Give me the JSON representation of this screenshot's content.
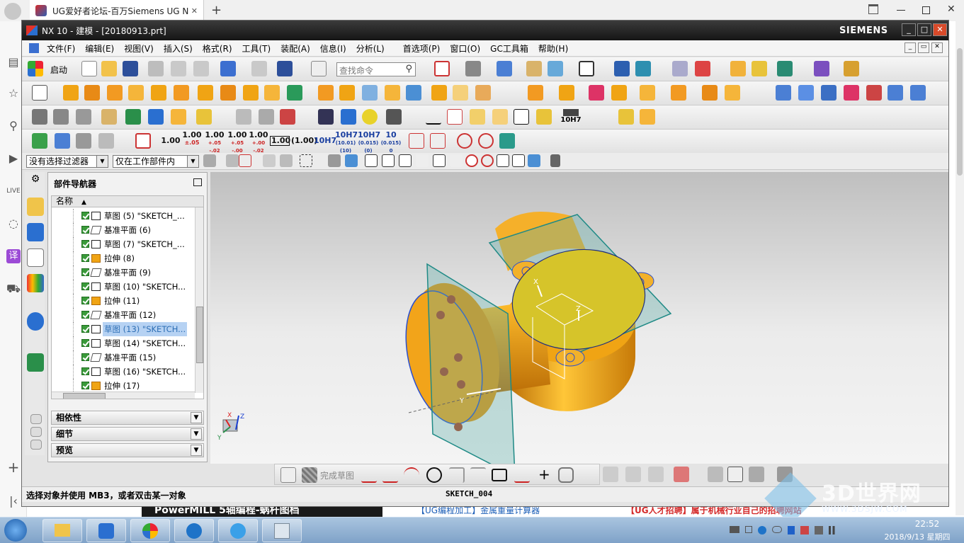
{
  "browser": {
    "tab_title": "UG爱好者论坛-百万Siemens UG N",
    "tab_close": "✕",
    "new_tab": "+"
  },
  "window": {
    "title": "NX 10 - 建模 - [20180913.prt]",
    "brand": "SIEMENS"
  },
  "menu": [
    "文件(F)",
    "编辑(E)",
    "视图(V)",
    "插入(S)",
    "格式(R)",
    "工具(T)",
    "装配(A)",
    "信息(I)",
    "分析(L)",
    "首选项(P)",
    "窗口(O)",
    "GC工具箱",
    "帮助(H)"
  ],
  "toolbar": {
    "start_label": "启动",
    "search_placeholder": "查找命令",
    "dim_values": [
      "1.00",
      "1.00",
      "1.00",
      "1.00",
      "1.00",
      "1.00",
      "(1.00)",
      "10H7",
      "10H7",
      "10H7",
      "10"
    ],
    "dim_subs": [
      "",
      "±.05",
      "+.05\n-.02",
      "+.05\n-.00",
      "+.00\n-.02",
      "",
      "",
      "",
      "(10.01)\n(10)",
      "(0.015)\n(0)",
      "(0.015)\n0"
    ],
    "fit_label": "10H7"
  },
  "filter": {
    "selection_filter": "没有选择过滤器",
    "scope": "仅在工作部件内"
  },
  "navigator": {
    "title": "部件导航器",
    "column_name": "名称",
    "rows": [
      {
        "icon": "sketch",
        "text": "草图 (5) \"SKETCH_..."
      },
      {
        "icon": "datum",
        "text": "基准平面 (6)"
      },
      {
        "icon": "sketch",
        "text": "草图 (7) \"SKETCH_..."
      },
      {
        "icon": "extrude",
        "text": "拉伸 (8)"
      },
      {
        "icon": "datum",
        "text": "基准平面 (9)"
      },
      {
        "icon": "sketch",
        "text": "草图 (10) \"SKETCH..."
      },
      {
        "icon": "extrude",
        "text": "拉伸 (11)"
      },
      {
        "icon": "datum",
        "text": "基准平面 (12)"
      },
      {
        "icon": "sketch",
        "text": "草图 (13) \"SKETCH...",
        "selected": true
      },
      {
        "icon": "sketch",
        "text": "草图 (14) \"SKETCH..."
      },
      {
        "icon": "datum",
        "text": "基准平面 (15)"
      },
      {
        "icon": "sketch",
        "text": "草图 (16) \"SKETCH..."
      },
      {
        "icon": "extrude",
        "text": "拉伸 (17)"
      }
    ],
    "panels": [
      "相依性",
      "细节",
      "预览"
    ]
  },
  "sketch_toolbar": {
    "finish_label": "完成草图"
  },
  "status": {
    "message": "选择对象并使用 MB3，或者双击某一对象",
    "sketch_name": "SKETCH_004"
  },
  "axes": {
    "x": "X",
    "y": "Y",
    "z": "Z"
  },
  "background_ads": [
    "PowerMILL 5轴编程-蜗杆图档",
    "【UG编程加工】金属重量计算器",
    "【UG人才招聘】属于机械行业自己的招聘网站"
  ],
  "watermark": {
    "brand": "3D世界网",
    "url": "WWW.3DSJW.COM"
  },
  "clock": {
    "time": "22:52",
    "date": "2018/9/13 星期四"
  },
  "colors": {
    "part": "#f0a414",
    "face": "#d8c72a",
    "datum": "#2e8f8c",
    "titlebar": "#1c1c1c",
    "close": "#d84a2a"
  }
}
